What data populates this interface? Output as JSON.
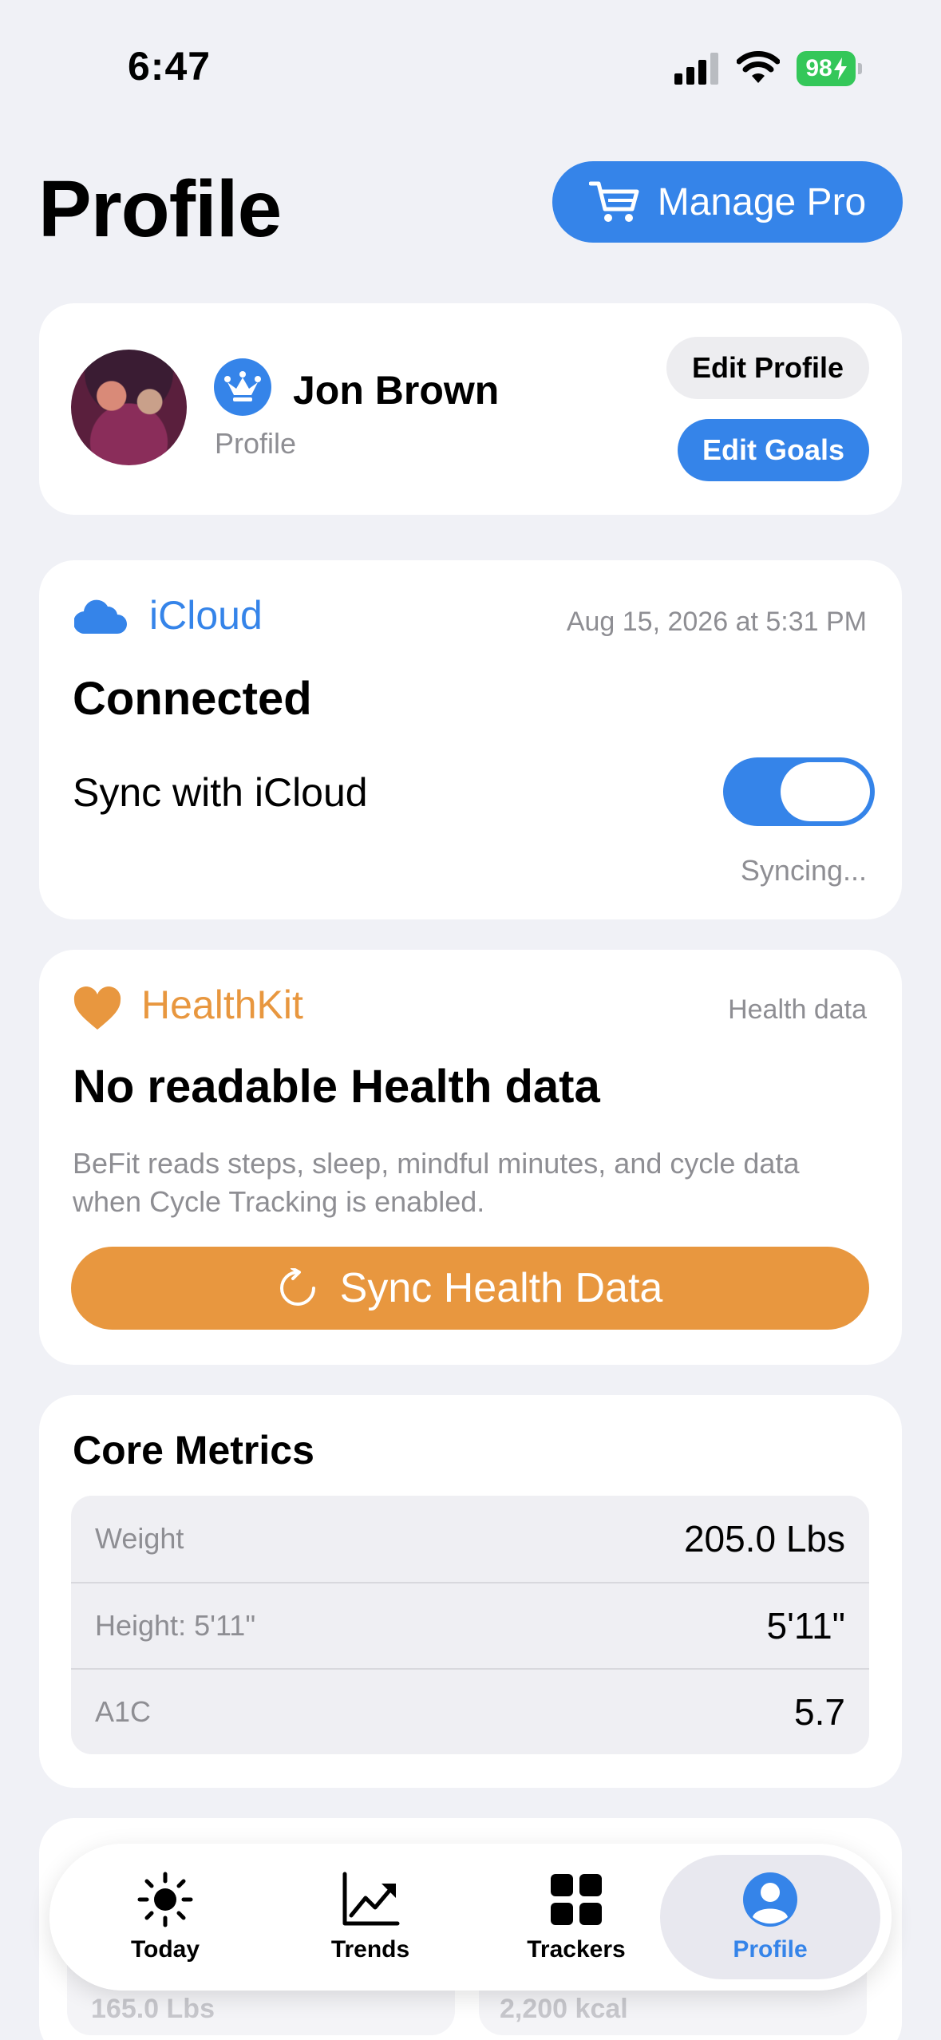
{
  "status_bar": {
    "time": "6:47",
    "battery": "98"
  },
  "header": {
    "title": "Profile",
    "manage_pro_label": "Manage Pro"
  },
  "profile": {
    "name": "Jon Brown",
    "subtitle": "Profile",
    "edit_profile_label": "Edit Profile",
    "edit_goals_label": "Edit Goals"
  },
  "icloud": {
    "label": "iCloud",
    "last_sync": "Aug 15, 2026 at 5:31 PM",
    "status": "Connected",
    "sync_label": "Sync with iCloud",
    "sync_enabled": true,
    "sync_state": "Syncing..."
  },
  "healthkit": {
    "label": "HealthKit",
    "note": "Health data",
    "title": "No readable Health data",
    "description": "BeFit reads steps, sleep, mindful minutes, and cycle data when Cycle Tracking is enabled.",
    "sync_button_label": "Sync Health Data"
  },
  "core_metrics": {
    "title": "Core Metrics",
    "rows": [
      {
        "label": "Weight",
        "value": "205.0 Lbs"
      },
      {
        "label": "Height: 5'11\"",
        "value": "5'11\""
      },
      {
        "label": "A1C",
        "value": "5.7"
      }
    ]
  },
  "hidden_cards": {
    "left_value": "165.0 Lbs",
    "right_value": "2,200 kcal"
  },
  "tab_bar": {
    "tabs": [
      {
        "label": "Today",
        "icon": "sun-icon"
      },
      {
        "label": "Trends",
        "icon": "chart-line-icon"
      },
      {
        "label": "Trackers",
        "icon": "grid-icon"
      },
      {
        "label": "Profile",
        "icon": "person-circle-icon"
      }
    ],
    "selected": "Profile"
  },
  "colors": {
    "accent_blue": "#3584E9",
    "health_orange": "#E8973F",
    "background": "#F0F1F6",
    "battery_green": "#34C759"
  }
}
